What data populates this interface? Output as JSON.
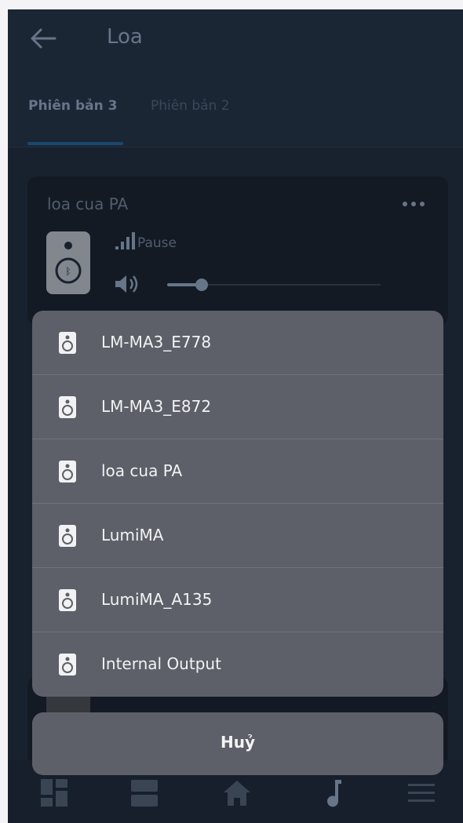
{
  "header": {
    "title": "Loa",
    "tabs": [
      {
        "label": "Phiên bản 3",
        "active": true
      },
      {
        "label": "Phiên bản 2",
        "active": false
      }
    ]
  },
  "card": {
    "title": "loa cua PA",
    "status": "Pause",
    "volume_fraction": 0.16
  },
  "sheet": {
    "options": [
      {
        "label": "LM-MA3_E778",
        "icon": "speaker-icon"
      },
      {
        "label": "LM-MA3_E872",
        "icon": "speaker-icon"
      },
      {
        "label": "loa cua PA",
        "icon": "speaker-icon"
      },
      {
        "label": "LumiMA",
        "icon": "speaker-icon"
      },
      {
        "label": "LumiMA_A135",
        "icon": "speaker-icon"
      },
      {
        "label": "Internal Output",
        "icon": "speaker-icon"
      }
    ],
    "cancel_label": "Huỷ"
  },
  "bottom_nav": [
    {
      "icon": "dashboard-icon"
    },
    {
      "icon": "list-view-icon"
    },
    {
      "icon": "home-icon"
    },
    {
      "icon": "music-note-icon"
    },
    {
      "icon": "menu-icon"
    }
  ]
}
